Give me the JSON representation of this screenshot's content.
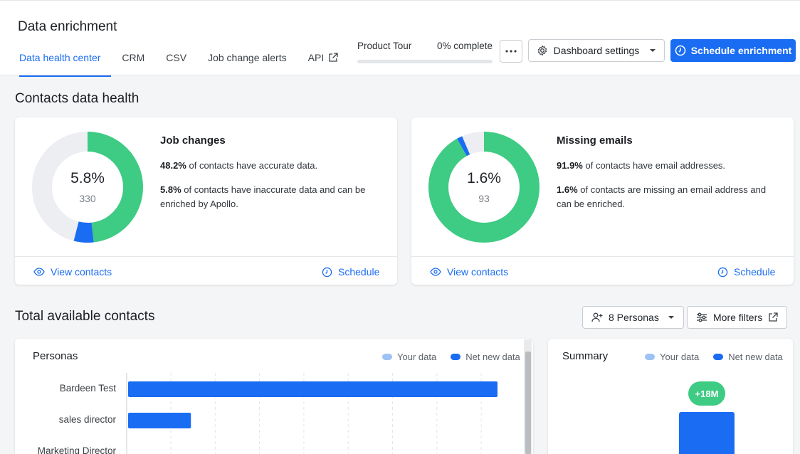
{
  "header": {
    "title": "Data enrichment",
    "tabs": [
      {
        "label": "Data health center"
      },
      {
        "label": "CRM"
      },
      {
        "label": "CSV"
      },
      {
        "label": "Job change alerts"
      },
      {
        "label": "API"
      }
    ],
    "tour": {
      "label": "Product Tour",
      "progress_text": "0% complete",
      "progress": 0
    },
    "settings_label": "Dashboard settings",
    "schedule_label": "Schedule enrichment"
  },
  "contacts_health": {
    "title": "Contacts data health",
    "cards": [
      {
        "heading": "Job changes",
        "center_pct": "5.8%",
        "center_count": "330",
        "line1_bold": "48.2%",
        "line1_text": " of contacts have accurate data.",
        "line2_bold": "5.8%",
        "line2_text": " of contacts have inaccurate data and can be enriched by Apollo.",
        "view_label": "View contacts",
        "schedule_label": "Schedule",
        "segments": [
          {
            "name": "accurate",
            "value": 48.2,
            "color": "#3ecb83"
          },
          {
            "name": "inaccurate",
            "value": 5.8,
            "color": "#1a6cf2"
          },
          {
            "name": "rest",
            "value": 46.0,
            "color": "#eceef1"
          }
        ]
      },
      {
        "heading": "Missing emails",
        "center_pct": "1.6%",
        "center_count": "93",
        "line1_bold": "91.9%",
        "line1_text": " of contacts have email addresses.",
        "line2_bold": "1.6%",
        "line2_text": " of contacts are missing an email address and can be enriched.",
        "view_label": "View contacts",
        "schedule_label": "Schedule",
        "segments": [
          {
            "name": "has-email",
            "value": 91.9,
            "color": "#3ecb83"
          },
          {
            "name": "missing",
            "value": 1.6,
            "color": "#1a6cf2"
          },
          {
            "name": "rest",
            "value": 6.5,
            "color": "#eceef1"
          }
        ]
      }
    ]
  },
  "available": {
    "title": "Total available contacts",
    "personas_button": "8 Personas",
    "filters_button": "More filters",
    "legend_your": "Your data",
    "legend_new": "Net new data",
    "color_your": "#9ec2f5",
    "color_new": "#1a6cf2",
    "personas_title": "Personas",
    "summary_title": "Summary",
    "summary_badge": "+18M"
  },
  "chart_data": {
    "type": "bar",
    "orientation": "horizontal",
    "title": "Personas",
    "categories": [
      "Bardeen Test",
      "sales director",
      "Marketing Director"
    ],
    "series": [
      {
        "name": "Net new data",
        "values": [
          100,
          17,
          null
        ]
      }
    ],
    "grid": true
  }
}
